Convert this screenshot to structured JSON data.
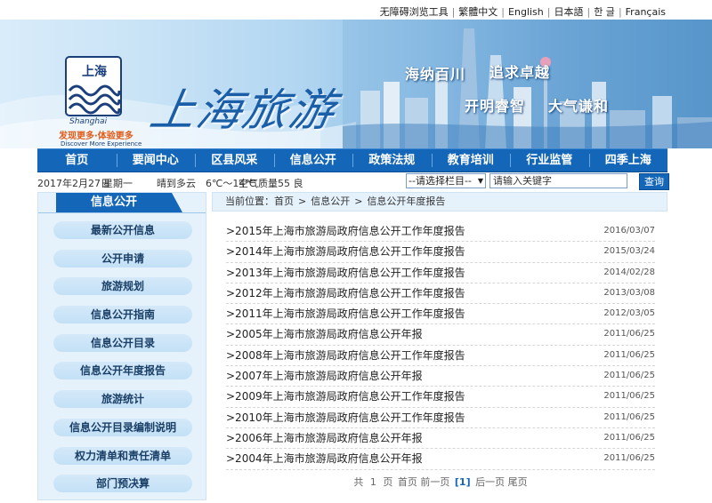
{
  "languages": [
    "无障碍浏览工具",
    "繁體中文",
    "English",
    "日本語",
    "한 글",
    "Français"
  ],
  "banner": {
    "logo_top": "上海",
    "logo_word": "Shanghai",
    "logo_slogan": "发现更多·体验更多",
    "logo_slogan_en": "Discover More Experience",
    "title": "上海旅游",
    "slogans": [
      "海纳百川",
      "追求卓越",
      "开明睿智",
      "大气谦和"
    ]
  },
  "nav": [
    "首页",
    "要闻中心",
    "区县风采",
    "信息公开",
    "政策法规",
    "教育培训",
    "行业监管",
    "四季上海"
  ],
  "infobar": {
    "date": "2017年2月27日",
    "weekday": "星期一",
    "weather": "晴到多云　6℃～14℃",
    "air_quality": "空气质量55 良",
    "select_value": "--请选择栏目--",
    "search_placeholder": "请输入关键字",
    "search_button": "查询"
  },
  "sidebar": {
    "title": "信息公开",
    "items": [
      "最新公开信息",
      "公开申请",
      "旅游规划",
      "信息公开指南",
      "信息公开目录",
      "信息公开年度报告",
      "旅游统计",
      "信息公开目录编制说明",
      "权力清单和责任清单",
      "部门预决算"
    ]
  },
  "breadcrumb": {
    "label": "当前位置：",
    "items": [
      "首页",
      "信息公开",
      "信息公开年度报告"
    ]
  },
  "reports": [
    {
      "title": ">2015年上海市旅游局政府信息公开工作年度报告",
      "date": "2016/03/07"
    },
    {
      "title": ">2014年上海市旅游局政府信息公开工作年度报告",
      "date": "2015/03/24"
    },
    {
      "title": ">2013年上海市旅游局政府信息公开工作年度报告",
      "date": "2014/02/28"
    },
    {
      "title": ">2012年上海市旅游局政府信息公开工作年度报告",
      "date": "2013/03/08"
    },
    {
      "title": ">2011年上海市旅游局政府信息公开工作年度报告",
      "date": "2012/03/05"
    },
    {
      "title": ">2005年上海市旅游局政府信息公开年报",
      "date": "2011/06/25"
    },
    {
      "title": ">2008年上海市旅游局政府信息公开工作年度报告",
      "date": "2011/06/25"
    },
    {
      "title": ">2007年上海市旅游局政府信息公开年报",
      "date": "2011/06/25"
    },
    {
      "title": ">2009年上海市旅游局政府信息公开工作年度报告",
      "date": "2011/06/25"
    },
    {
      "title": ">2010年上海市旅游局政府信息公开工作年度报告",
      "date": "2011/06/25"
    },
    {
      "title": ">2006年上海市旅游局政府信息公开年报",
      "date": "2011/06/25"
    },
    {
      "title": ">2004年上海市旅游局政府信息公开年报",
      "date": "2011/06/25"
    }
  ],
  "pager": {
    "total_prefix": "共",
    "total": "1",
    "total_suffix": "页",
    "first": "首页",
    "prev": "前一页",
    "current": "[1]",
    "next": "后一页",
    "last": "尾页"
  },
  "colors": {
    "nav": "#1466b8",
    "sidebar_bg": "#e6f2fb",
    "pill": "#c3e0f6"
  }
}
